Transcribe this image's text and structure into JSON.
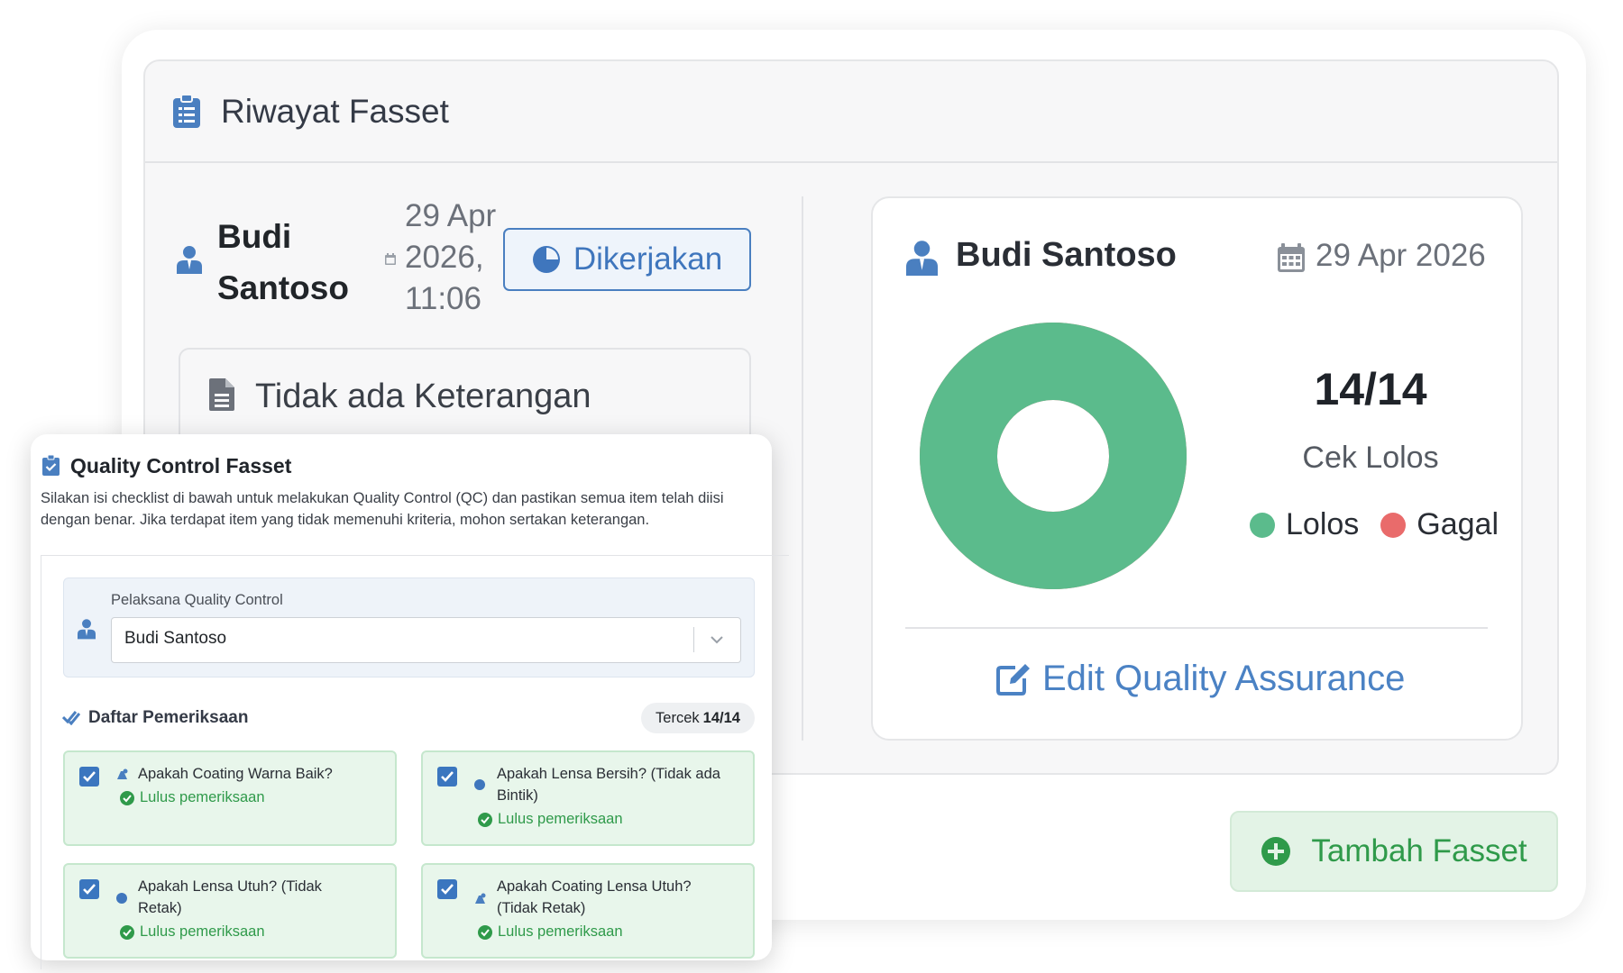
{
  "panel": {
    "title": "Riwayat Fasset"
  },
  "entry": {
    "name": "Budi Santoso",
    "date": "29 Apr 2026, 11:06",
    "status": "Dikerjakan",
    "note": "Tidak ada Keterangan"
  },
  "stats": {
    "name": "Budi Santoso",
    "date": "29 Apr 2026",
    "count": "14/14",
    "label": "Cek Lolos",
    "legend_pass": "Lolos",
    "legend_fail": "Gagal",
    "pass_color": "#5bbb8c",
    "fail_color": "#e96b6b",
    "passed": 14,
    "total": 14,
    "edit_label": "Edit Quality Assurance"
  },
  "add_button": {
    "label": "Tambah Fasset"
  },
  "qc": {
    "title": "Quality Control Fasset",
    "description": "Silakan isi checklist di bawah untuk melakukan Quality Control (QC) dan pastikan semua item telah diisi dengan benar. Jika terdapat item yang tidak memenuhi kriteria, mohon sertakan keterangan.",
    "executor_label": "Pelaksana Quality Control",
    "executor_value": "Budi Santoso",
    "list_title": "Daftar Pemeriksaan",
    "progress_prefix": "Tercek",
    "progress_value": "14/14",
    "items": [
      {
        "question": "Apakah Coating Warna Baik?",
        "status": "Lulus pemeriksaan",
        "icon": "palette-icon",
        "checked": true
      },
      {
        "question": "Apakah Lensa Bersih? (Tidak ada Bintik)",
        "status": "Lulus pemeriksaan",
        "icon": "dot-icon",
        "checked": true
      },
      {
        "question": "Apakah Lensa Utuh? (Tidak Retak)",
        "status": "Lulus pemeriksaan",
        "icon": "dot-icon",
        "checked": true
      },
      {
        "question": "Apakah Coating Lensa Utuh? (Tidak Retak)",
        "status": "Lulus pemeriksaan",
        "icon": "palette-icon",
        "checked": true
      }
    ]
  }
}
